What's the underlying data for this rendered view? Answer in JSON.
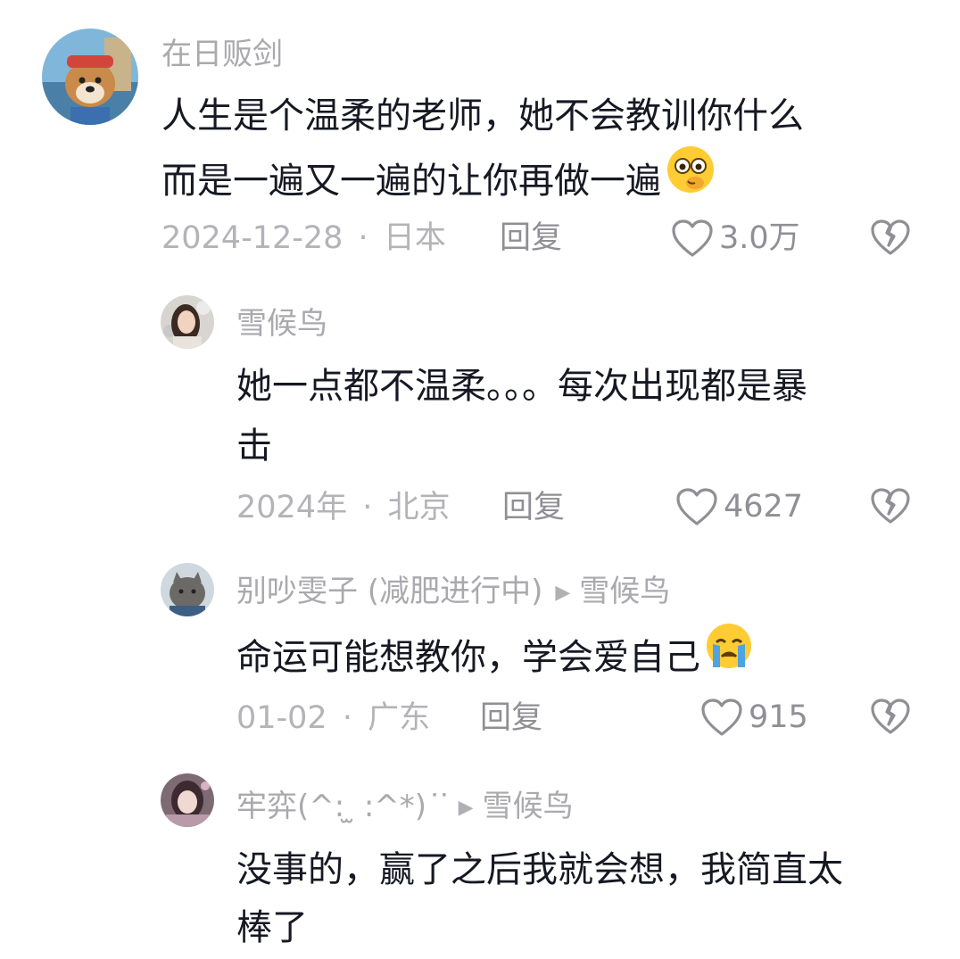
{
  "comments": [
    {
      "username": "在日贩剑",
      "lines": [
        "人生是个温柔的老师，她不会教训你什么",
        "而是一遍又一遍的让你再做一遍"
      ],
      "emoji": "monocle-face-emoji",
      "date": "2024-12-28",
      "location": "日本",
      "reply_label": "回复",
      "likes": "3.0万"
    },
    {
      "username": "雪候鸟",
      "lines": [
        "她一点都不温柔。。。每次出现都是暴",
        "击"
      ],
      "date": "2024年",
      "location": "北京",
      "reply_label": "回复",
      "likes": "4627"
    },
    {
      "username": "别吵雯子 (减肥进行中)",
      "reply_to": "雪候鸟",
      "lines": [
        "命运可能想教你，学会爱自己"
      ],
      "emoji": "crying-face-emoji",
      "date": "01-02",
      "location": "广东",
      "reply_label": "回复",
      "likes": "915"
    },
    {
      "username": "牢弈(^: ̫ :^*) ͘ ͘",
      "reply_to": "雪候鸟",
      "lines": [
        "没事的，赢了之后我就会想，我简直太",
        "棒了"
      ]
    }
  ],
  "separator": "·",
  "colors": {
    "text": "#161823",
    "muted": "#a9a9ae",
    "action": "#8f8f95"
  }
}
